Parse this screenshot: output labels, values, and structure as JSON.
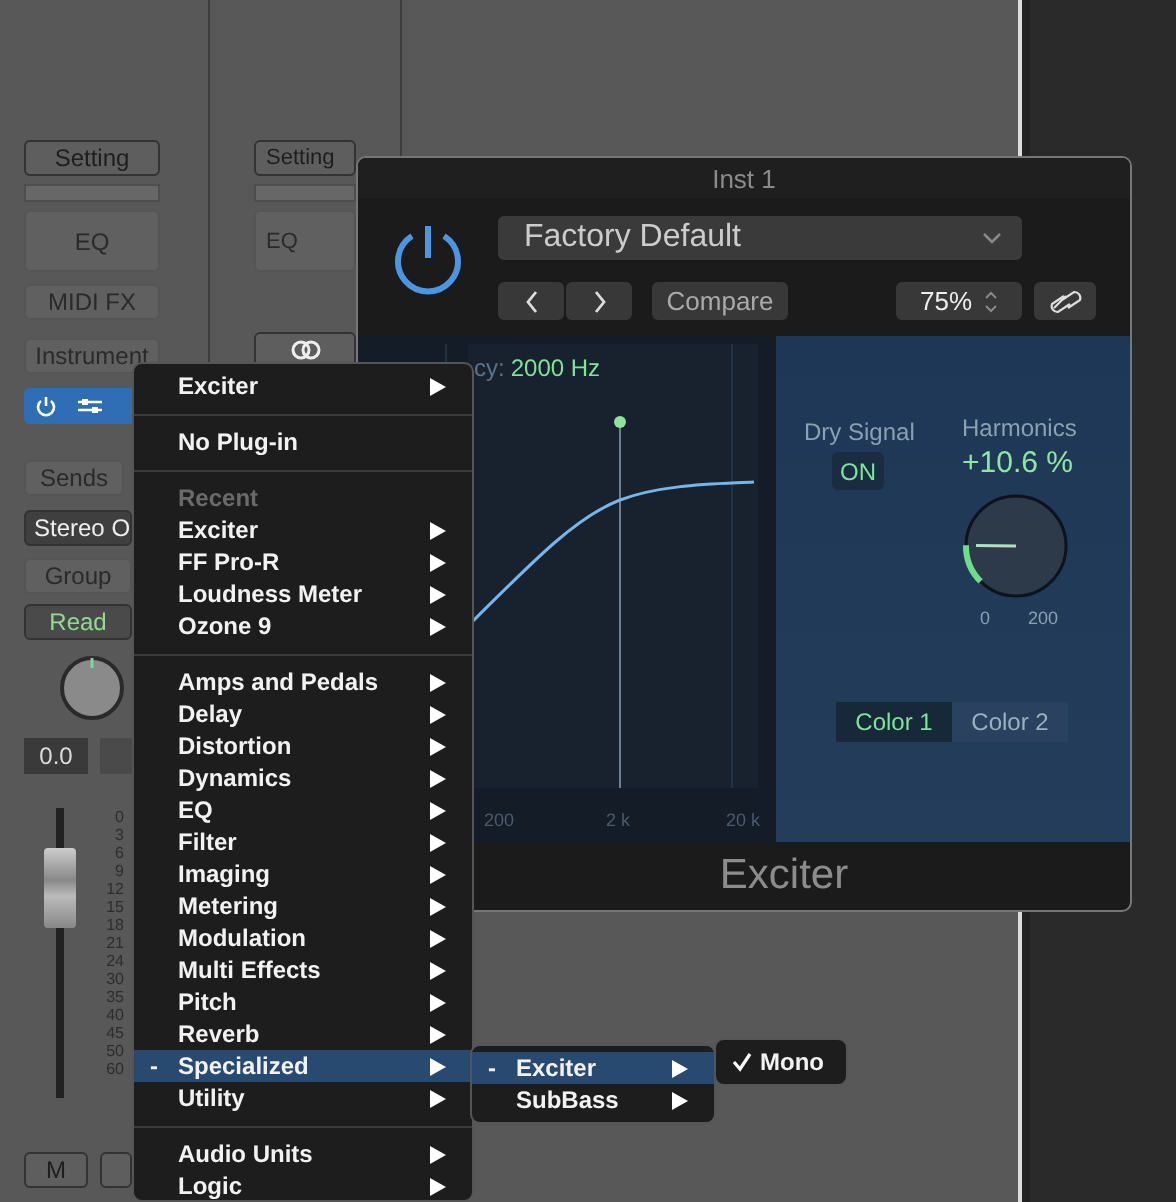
{
  "strips": [
    {
      "setting": "Setting",
      "eq": "EQ",
      "midi_fx": "MIDI FX",
      "instrument": "Instrument",
      "plugin_on": true,
      "sends": "Sends",
      "output": "Stereo O",
      "group": "Group",
      "automation": "Read",
      "volume": "0.0",
      "fader": {
        "level": 0.74
      },
      "scale": [
        "0",
        "3",
        "6",
        "9",
        "12",
        "15",
        "18",
        "21",
        "24",
        "30",
        "35",
        "40",
        "45",
        "50",
        "60"
      ],
      "mute": "M"
    },
    {
      "setting": "Setting",
      "eq": "EQ"
    }
  ],
  "plugin_window": {
    "title": "Inst 1",
    "power_on": true,
    "preset": "Factory Default",
    "compare": "Compare",
    "zoom": "75%",
    "frequency_label": "cy:",
    "frequency_value": "2000 Hz",
    "x_ticks": [
      "200",
      "2 k",
      "20 k"
    ],
    "dry_signal": {
      "label": "Dry Signal",
      "value": "ON",
      "on": true
    },
    "harmonics": {
      "label": "Harmonics",
      "value": "+10.6 %",
      "level": 0.17,
      "min": "0",
      "max": "200"
    },
    "colors": [
      {
        "label": "Color 1",
        "selected": true
      },
      {
        "label": "Color 2",
        "selected": false
      }
    ],
    "plugin_name": "Exciter"
  },
  "menu": [
    {
      "kind": "item",
      "label": "Exciter",
      "submenu": true,
      "selected": false
    },
    {
      "kind": "separator"
    },
    {
      "kind": "item",
      "label": "No Plug-in",
      "submenu": false,
      "selected": false
    },
    {
      "kind": "separator"
    },
    {
      "kind": "header",
      "label": "Recent"
    },
    {
      "kind": "item",
      "label": "Exciter",
      "submenu": true,
      "selected": false
    },
    {
      "kind": "item",
      "label": "FF Pro-R",
      "submenu": true,
      "selected": false
    },
    {
      "kind": "item",
      "label": "Loudness Meter",
      "submenu": true,
      "selected": false
    },
    {
      "kind": "item",
      "label": "Ozone 9",
      "submenu": true,
      "selected": false
    },
    {
      "kind": "separator"
    },
    {
      "kind": "item",
      "label": "Amps and Pedals",
      "submenu": true,
      "selected": false
    },
    {
      "kind": "item",
      "label": "Delay",
      "submenu": true,
      "selected": false
    },
    {
      "kind": "item",
      "label": "Distortion",
      "submenu": true,
      "selected": false
    },
    {
      "kind": "item",
      "label": "Dynamics",
      "submenu": true,
      "selected": false
    },
    {
      "kind": "item",
      "label": "EQ",
      "submenu": true,
      "selected": false
    },
    {
      "kind": "item",
      "label": "Filter",
      "submenu": true,
      "selected": false
    },
    {
      "kind": "item",
      "label": "Imaging",
      "submenu": true,
      "selected": false
    },
    {
      "kind": "item",
      "label": "Metering",
      "submenu": true,
      "selected": false
    },
    {
      "kind": "item",
      "label": "Modulation",
      "submenu": true,
      "selected": false
    },
    {
      "kind": "item",
      "label": "Multi Effects",
      "submenu": true,
      "selected": false
    },
    {
      "kind": "item",
      "label": "Pitch",
      "submenu": true,
      "selected": false
    },
    {
      "kind": "item",
      "label": "Reverb",
      "submenu": true,
      "selected": false
    },
    {
      "kind": "item",
      "label": "Specialized",
      "marker": "-",
      "submenu": true,
      "selected": true
    },
    {
      "kind": "item",
      "label": "Utility",
      "submenu": true,
      "selected": false
    },
    {
      "kind": "separator"
    },
    {
      "kind": "item",
      "label": "Audio Units",
      "submenu": true,
      "selected": false
    },
    {
      "kind": "item",
      "label": "Logic",
      "submenu": true,
      "selected": false
    }
  ],
  "submenu": [
    {
      "kind": "item",
      "label": "Exciter",
      "marker": "-",
      "submenu": true,
      "selected": true
    },
    {
      "kind": "item",
      "label": "SubBass",
      "submenu": true,
      "selected": false
    }
  ],
  "subsubmenu": [
    {
      "label": "Mono",
      "checked": true
    }
  ]
}
